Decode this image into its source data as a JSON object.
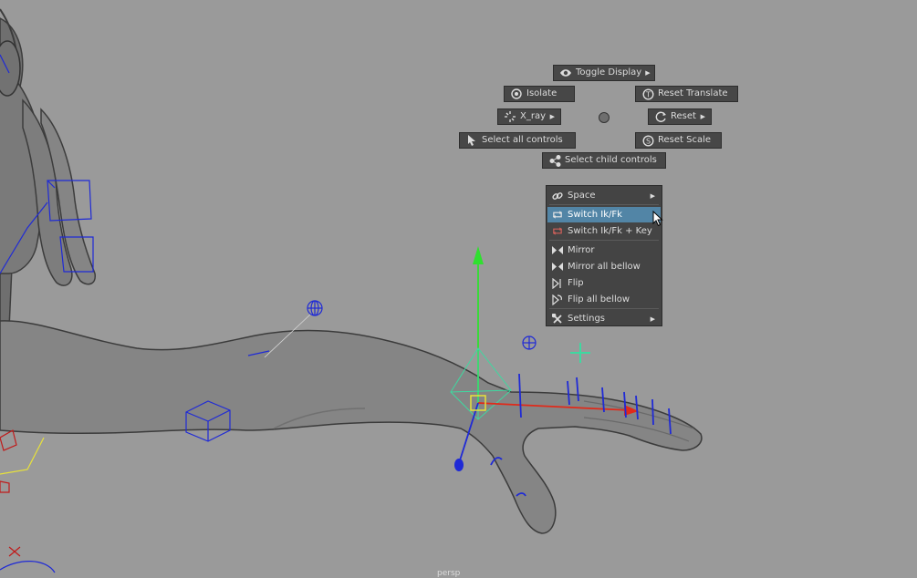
{
  "marking_menu": {
    "toggle_display": "Toggle Display",
    "isolate": "Isolate",
    "reset_translate": "Reset Translate",
    "x_ray": "X_ray",
    "reset": "Reset",
    "select_all_controls": "Select all controls",
    "reset_scale": "Reset Scale",
    "select_child_controls": "Select child controls"
  },
  "context_menu": {
    "items": [
      {
        "label": "Space",
        "icon": "link-icon",
        "has_submenu": true
      },
      {
        "label": "Switch Ik/Fk",
        "icon": "switch-icon",
        "highlighted": true
      },
      {
        "label": "Switch Ik/Fk + Key",
        "icon": "switch-key-icon"
      },
      {
        "label": "Mirror",
        "icon": "mirror-icon"
      },
      {
        "label": "Mirror all bellow",
        "icon": "mirror-all-icon"
      },
      {
        "label": "Flip",
        "icon": "flip-icon"
      },
      {
        "label": "Flip all bellow",
        "icon": "flip-all-icon"
      },
      {
        "label": "Settings",
        "icon": "wrench-icon",
        "has_submenu": true
      }
    ]
  },
  "viewport": {
    "camera_label": "persp"
  },
  "colors": {
    "viewport_bg": "#9a9a9a",
    "menu_bg": "#474747",
    "highlight": "#5285a6",
    "control_blue": "#1f2ad6",
    "control_green": "#2fe02f",
    "control_red": "#e02a1a",
    "control_yellow": "#e8e23a"
  }
}
